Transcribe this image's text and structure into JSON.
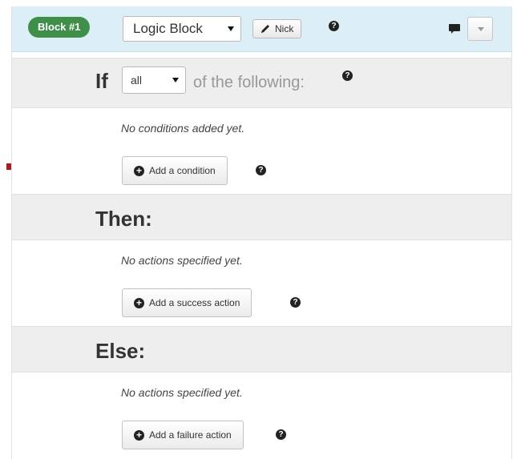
{
  "header": {
    "block_label": "Block #1",
    "block_type": "Logic Block",
    "author_button": "Nick",
    "help": "?",
    "icons": [
      "pencil-icon",
      "help-icon",
      "comment-icon",
      "chevron-down-icon"
    ]
  },
  "condition": {
    "if_label": "If",
    "quantifier": "all",
    "suffix": "of the following:",
    "empty": "No conditions added yet.",
    "add_button": "Add a condition"
  },
  "then": {
    "title": "Then:",
    "empty": "No actions specified yet.",
    "add_button": "Add a success action"
  },
  "else": {
    "title": "Else:",
    "empty": "No actions specified yet.",
    "add_button": "Add a failure action"
  },
  "colors": {
    "badge": "#3f8f4a",
    "header_bg": "#dceef6",
    "section_bg": "#eeeeee",
    "arrow": "#a51d24"
  }
}
